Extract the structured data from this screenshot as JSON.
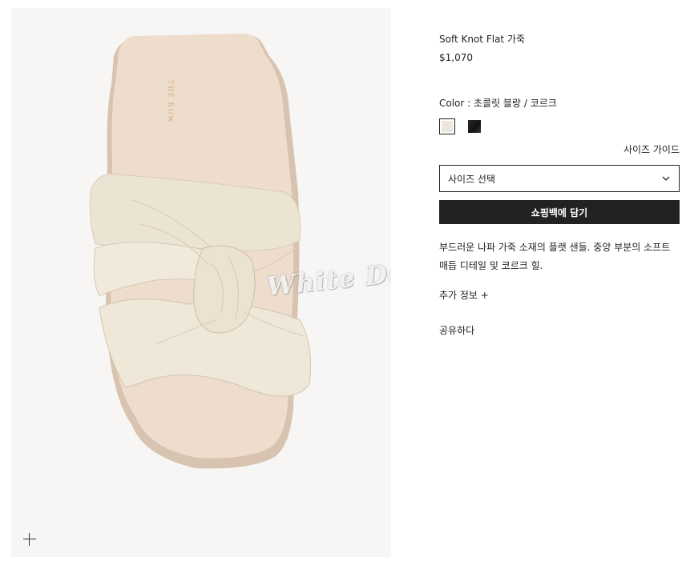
{
  "product": {
    "title": "Soft Knot Flat 가죽",
    "price": "$1,070",
    "color_label": "Color : 초콜릿 블랑 / 코르크",
    "swatches": [
      {
        "name": "ivory",
        "color": "#ece6dc",
        "selected": true
      },
      {
        "name": "black",
        "color": "#1e1e1e",
        "selected": false
      }
    ],
    "size_guide": "사이즈 가이드",
    "size_select_placeholder": "사이즈 선택",
    "add_to_bag": "쇼핑백에 담기",
    "description": "부드러운 나파 가죽 소재의 플랫 샌들. 중앙 부분의 소프트 매듭 디테일 및 코르크 힐.",
    "more_info": "추가 정보 +",
    "share": "공유하다"
  },
  "image": {
    "watermark": "White Devil",
    "insole_logo": "THE ROW"
  },
  "colors": {
    "accent": "#222222",
    "image_bg": "#f7f6f4"
  }
}
